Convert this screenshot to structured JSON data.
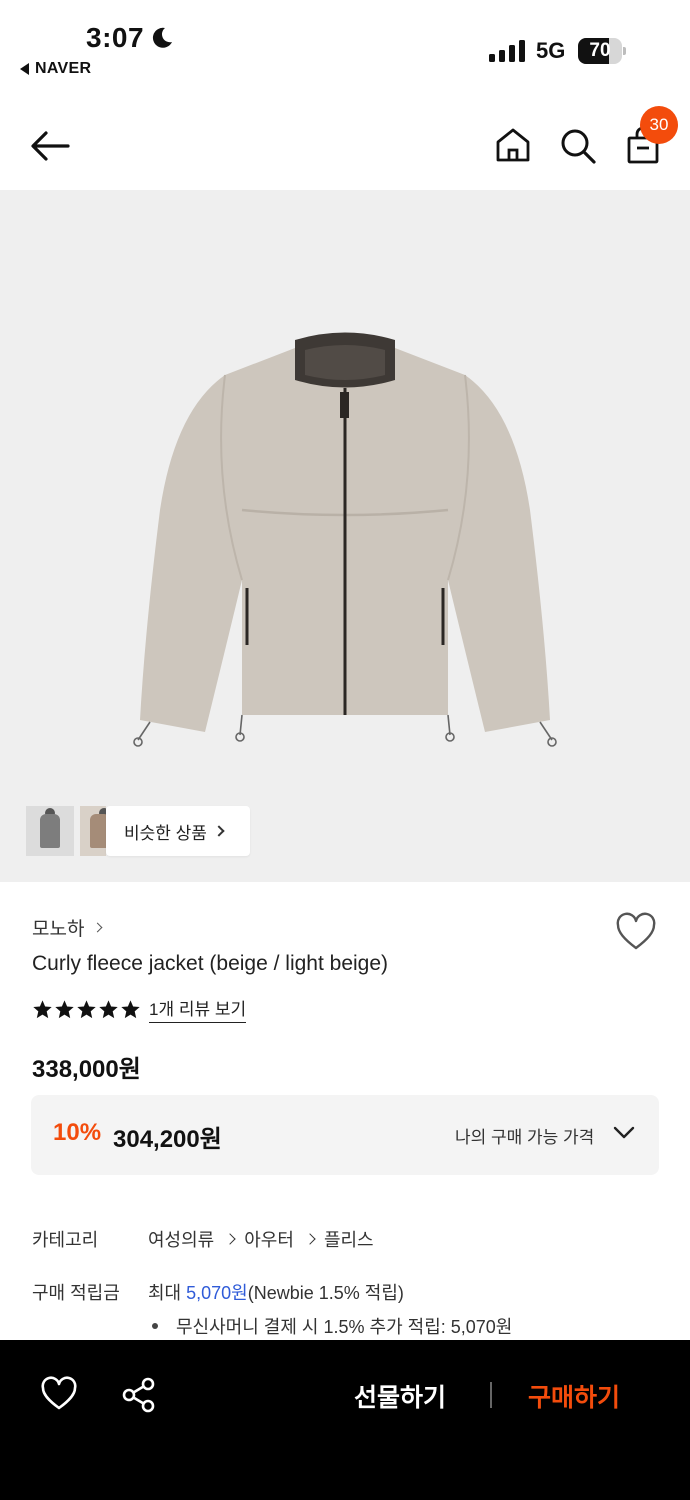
{
  "status_bar": {
    "time": "3:07",
    "back_app": "NAVER",
    "network": "5G",
    "battery": "70",
    "battery_level": 0.7
  },
  "nav": {
    "cart_count": "30",
    "icons": [
      "back-arrow-icon",
      "home-icon",
      "search-icon",
      "cart-icon"
    ]
  },
  "gallery": {
    "similar_label": "비슷한 상품"
  },
  "product": {
    "brand": "모노하",
    "title": "Curly fleece jacket (beige / light beige)",
    "rating_stars": 5,
    "review_link": "1개 리뷰 보기",
    "price": "338,000원",
    "discount_rate": "10%",
    "discount_price": "304,200원",
    "my_price_label": "나의 구매 가능 가격"
  },
  "details": {
    "category_label": "카테고리",
    "category_path": [
      "여성의류",
      "아우터",
      "플리스"
    ],
    "points_label": "구매 적립금",
    "points_prefix": "최대",
    "points_amount": "5,070원",
    "points_suffix": "(Newbie 1.5% 적립)",
    "points_bullet": "무신사머니 결제 시 1.5% 추가 적립: 5,070원"
  },
  "bottom_bar": {
    "gift_label": "선물하기",
    "buy_label": "구매하기"
  },
  "colors": {
    "accent": "#f34c0c",
    "link_blue": "#2f5bd8",
    "hero_bg": "#efefef"
  }
}
